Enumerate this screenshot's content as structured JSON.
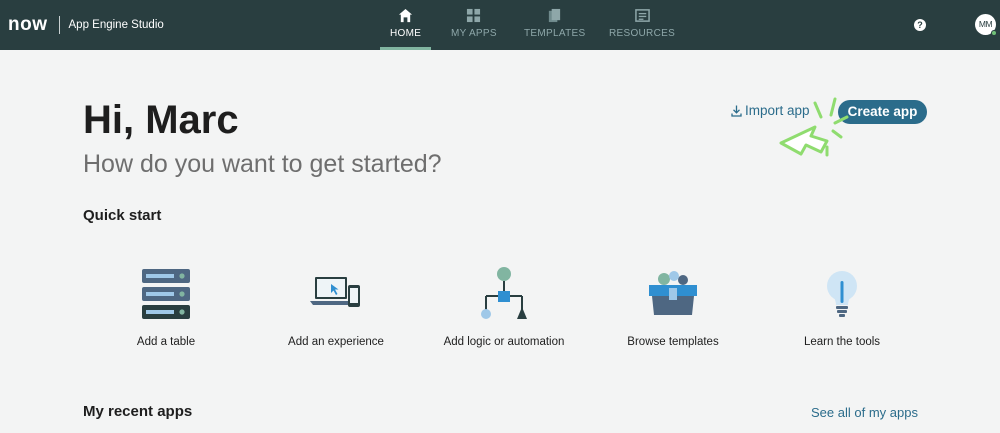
{
  "header": {
    "logo": "now",
    "app_title": "App Engine Studio",
    "tabs": [
      {
        "label": "HOME",
        "icon": "home-icon",
        "active": true
      },
      {
        "label": "MY APPS",
        "icon": "grid-icon",
        "active": false
      },
      {
        "label": "TEMPLATES",
        "icon": "templates-icon",
        "active": false
      },
      {
        "label": "RESOURCES",
        "icon": "resources-icon",
        "active": false
      }
    ],
    "help": "?",
    "avatar_initials": "MM"
  },
  "main": {
    "greeting": "Hi, Marc",
    "subtitle": "How do you want to get started?",
    "import_label": "Import app",
    "create_label": "Create app",
    "quick_start_title": "Quick start",
    "quick_start": [
      {
        "label": "Add a table",
        "icon": "database-icon"
      },
      {
        "label": "Add an experience",
        "icon": "devices-icon"
      },
      {
        "label": "Add logic or automation",
        "icon": "flow-icon"
      },
      {
        "label": "Browse templates",
        "icon": "templates-box-icon"
      },
      {
        "label": "Learn the tools",
        "icon": "lightbulb-icon"
      }
    ],
    "recent_title": "My recent apps",
    "see_all_label": "See all of my apps"
  },
  "colors": {
    "header_bg": "#293e40",
    "accent": "#2b6c8b",
    "active_underline": "#81b5a1",
    "page_bg": "#f3f4f4"
  }
}
